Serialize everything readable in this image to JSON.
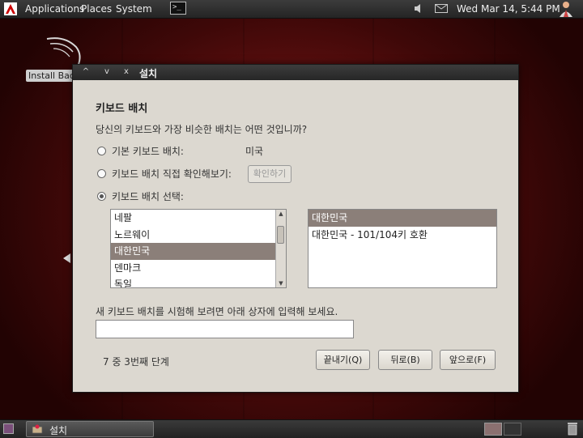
{
  "top_panel": {
    "menus": [
      "Applications",
      "Places",
      "System"
    ],
    "terminal_glyph": ">_",
    "clock": "Wed Mar 14,  5:44 PM",
    "icons": [
      "terminal-icon",
      "volume-icon",
      "mail-icon",
      "user-icon"
    ]
  },
  "desktop": {
    "icon_label": "Install Backtrack"
  },
  "window": {
    "title": "설치",
    "controls": [
      "^",
      "v",
      "x"
    ],
    "heading": "키보드 배치",
    "question": "당신의 키보드와 가장 비슷한 배치는 어떤 것입니까?",
    "options": {
      "default_label": "기본 키보드 배치:",
      "default_value": "미국",
      "test_label": "키보드 배치 직접 확인해보기:",
      "test_button": "확인하기",
      "choose_label": "키보드 배치 선택:"
    },
    "selected_option": "choose",
    "layouts": [
      "네팔",
      "노르웨이",
      "대한민국",
      "덴마크",
      "독일"
    ],
    "selected_layout": "대한민국",
    "variants": [
      "대한민국",
      "대한민국 - 101/104키 호환"
    ],
    "selected_variant": "대한민국",
    "test_instruction": "새 키보드 배치를 시험해 보려면 아래 상자에 입력해 보세요.",
    "test_input_value": "",
    "step": "7 중 3번째 단계",
    "buttons": {
      "quit": "끝내기(Q)",
      "back": "뒤로(B)",
      "forward": "앞으로(F)"
    }
  },
  "bottom_panel": {
    "task_label": "설치"
  },
  "colors": {
    "selection": "#8b7f79",
    "window_bg": "#dcd8d0",
    "panel_bg": "#2e2e2e",
    "desktop_red": "#7a1616"
  }
}
